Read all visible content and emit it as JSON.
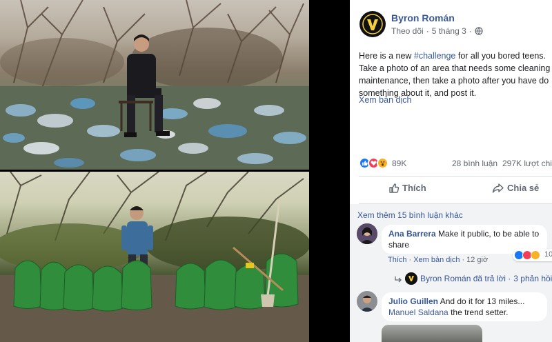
{
  "photo": {
    "description_alt": ""
  },
  "post": {
    "author": "Byron Román",
    "follow_label": "Theo dõi",
    "date": "5 tháng 3",
    "text_lines": [
      "Here is a new ",
      "Take a photo of an area that needs some cleaning",
      "maintenance, then take a photo after you have do",
      "something about it, and post it."
    ],
    "hashtag": "#challenge",
    "text_line1_suffix": " for all you bored teens.",
    "see_translation": "Xem bản dịch",
    "reactions_count": "89K",
    "comments_count": "28 bình luận",
    "shares_count": "297K lượt chi",
    "like_label": "Thích",
    "share_label": "Chia sẻ"
  },
  "comments": {
    "more_label": "Xem thêm 15 bình luận khác",
    "items": [
      {
        "name": "Ana Barrera",
        "text_line1": "Make it public, to be able to",
        "text_line2": "share",
        "like": "Thích",
        "translate": "Xem bản dịch",
        "time": "12 giờ",
        "reaction_count": "10"
      },
      {
        "name": "Julio Guillen",
        "text_line1": "And do it for 13 miles...",
        "mention": "Manuel Saldana",
        "text_line2_suffix": " the trend setter."
      }
    ],
    "reply": {
      "author": "Byron Román",
      "replied_label": "đã trả lời",
      "sep": "·",
      "reply_count": "3 phản hồi"
    }
  },
  "colors": {
    "link": "#385898",
    "like_blue": "#1877f2",
    "love_red": "#f33e58",
    "wow_yellow": "#f7b125"
  },
  "icons": [
    "globe-icon",
    "like-icon",
    "share-icon",
    "reply-arrow-icon"
  ]
}
